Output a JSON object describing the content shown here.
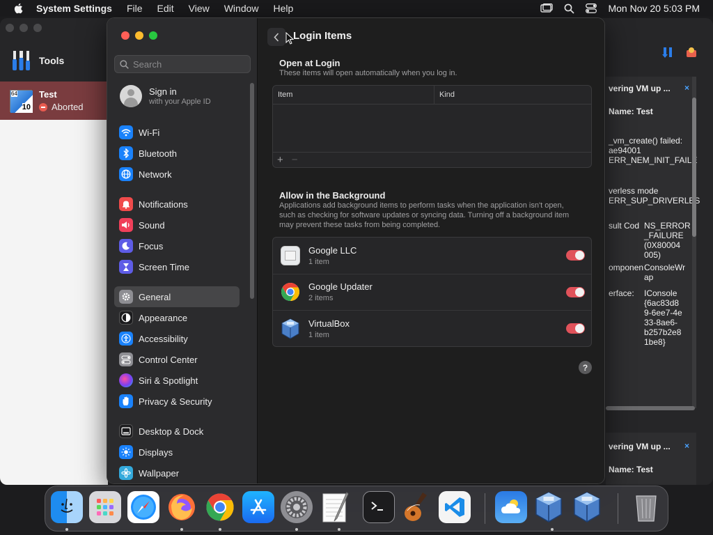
{
  "menubar": {
    "app_name": "System Settings",
    "items": [
      "File",
      "Edit",
      "View",
      "Window",
      "Help"
    ],
    "clock": "Mon Nov 20  5:03 PM"
  },
  "vbox": {
    "tools_label": "Tools",
    "vm_name": "Test",
    "vm_state": "Aborted",
    "vm_badge_top": "64",
    "vm_badge_bottom": "10",
    "notification1": {
      "title": "vering VM up ...",
      "close": "×",
      "name_line": "Name: Test",
      "lines": [
        "_vm_create() failed:",
        "ae94001",
        "ERR_NEM_INIT_FAILE"
      ],
      "lines2": [
        "verless mode",
        "ERR_SUP_DRIVERLES"
      ],
      "result_label": "sult Cod",
      "result_value": "NS_ERROR\n_FAILURE\n(0X80004\n005)",
      "component_label": "omponen",
      "component_value": "ConsoleWr\nap",
      "interface_label": "erface:",
      "interface_value": "IConsole\n{6ac83d8\n9-6ee7-4e\n33-8ae6-\nb257b2e8\n1be8}"
    },
    "notification2": {
      "title": "vering VM up ...",
      "close": "×",
      "name_line": "Name: Test"
    }
  },
  "settings": {
    "search_placeholder": "Search",
    "signin_title": "Sign in",
    "signin_sub": "with your Apple ID",
    "groups": [
      [
        {
          "label": "Wi-Fi",
          "icon": "wifi-icon",
          "color": "#1a82fb"
        },
        {
          "label": "Bluetooth",
          "icon": "bluetooth-icon",
          "color": "#1a82fb"
        },
        {
          "label": "Network",
          "icon": "globe-icon",
          "color": "#1a82fb"
        }
      ],
      [
        {
          "label": "Notifications",
          "icon": "bell-icon",
          "color": "#f04b4b"
        },
        {
          "label": "Sound",
          "icon": "speaker-icon",
          "color": "#f0405a"
        },
        {
          "label": "Focus",
          "icon": "moon-icon",
          "color": "#5e5ce6"
        },
        {
          "label": "Screen Time",
          "icon": "hourglass-icon",
          "color": "#5e5ce6"
        }
      ],
      [
        {
          "label": "General",
          "icon": "gear-icon",
          "color": "#8e8e93",
          "selected": true
        },
        {
          "label": "Appearance",
          "icon": "appearance-icon",
          "color": "#1c1c1e"
        },
        {
          "label": "Accessibility",
          "icon": "accessibility-icon",
          "color": "#1a82fb"
        },
        {
          "label": "Control Center",
          "icon": "control-center-icon",
          "color": "#8e8e93"
        },
        {
          "label": "Siri & Spotlight",
          "icon": "siri-icon",
          "color": "#b04fe0"
        },
        {
          "label": "Privacy & Security",
          "icon": "hand-icon",
          "color": "#1a82fb"
        }
      ],
      [
        {
          "label": "Desktop & Dock",
          "icon": "dock-icon",
          "color": "#1c1c1e"
        },
        {
          "label": "Displays",
          "icon": "sun-icon",
          "color": "#1a82fb"
        },
        {
          "label": "Wallpaper",
          "icon": "wallpaper-icon",
          "color": "#34aadc"
        }
      ]
    ],
    "detail": {
      "title": "Login Items",
      "open_at_login_title": "Open at Login",
      "open_at_login_sub": "These items will open automatically when you log in.",
      "col_item": "Item",
      "col_kind": "Kind",
      "add": "+",
      "remove": "−",
      "background_title": "Allow in the Background",
      "background_sub": "Applications add background items to perform tasks when the application isn't open, such as checking for software updates or syncing data. Turning off a background item may prevent these tasks from being completed.",
      "background_items": [
        {
          "name": "Google LLC",
          "count": "1 item",
          "icon": "generic-app-icon",
          "enabled": true
        },
        {
          "name": "Google Updater",
          "count": "2 items",
          "icon": "chrome-icon",
          "enabled": true
        },
        {
          "name": "VirtualBox",
          "count": "1 item",
          "icon": "virtualbox-icon",
          "enabled": true
        }
      ],
      "help": "?"
    }
  },
  "dock": {
    "apps": [
      {
        "name": "finder-icon",
        "running": true
      },
      {
        "name": "launchpad-icon",
        "running": false
      },
      {
        "name": "safari-icon",
        "running": false
      },
      {
        "name": "firefox-icon",
        "running": true
      },
      {
        "name": "chrome-icon",
        "running": true
      },
      {
        "name": "app-store-icon",
        "running": false
      },
      {
        "name": "system-settings-icon",
        "running": true
      },
      {
        "name": "textedit-icon",
        "running": true
      },
      {
        "name": "terminal-icon",
        "running": false
      },
      {
        "name": "garageband-icon",
        "running": false
      },
      {
        "name": "vscode-icon",
        "running": false
      },
      {
        "name": "weather-icon",
        "running": false
      },
      {
        "name": "virtualbox-icon",
        "running": true
      },
      {
        "name": "virtualbox-vm-icon",
        "running": false
      },
      {
        "name": "trash-icon",
        "running": false
      }
    ]
  }
}
